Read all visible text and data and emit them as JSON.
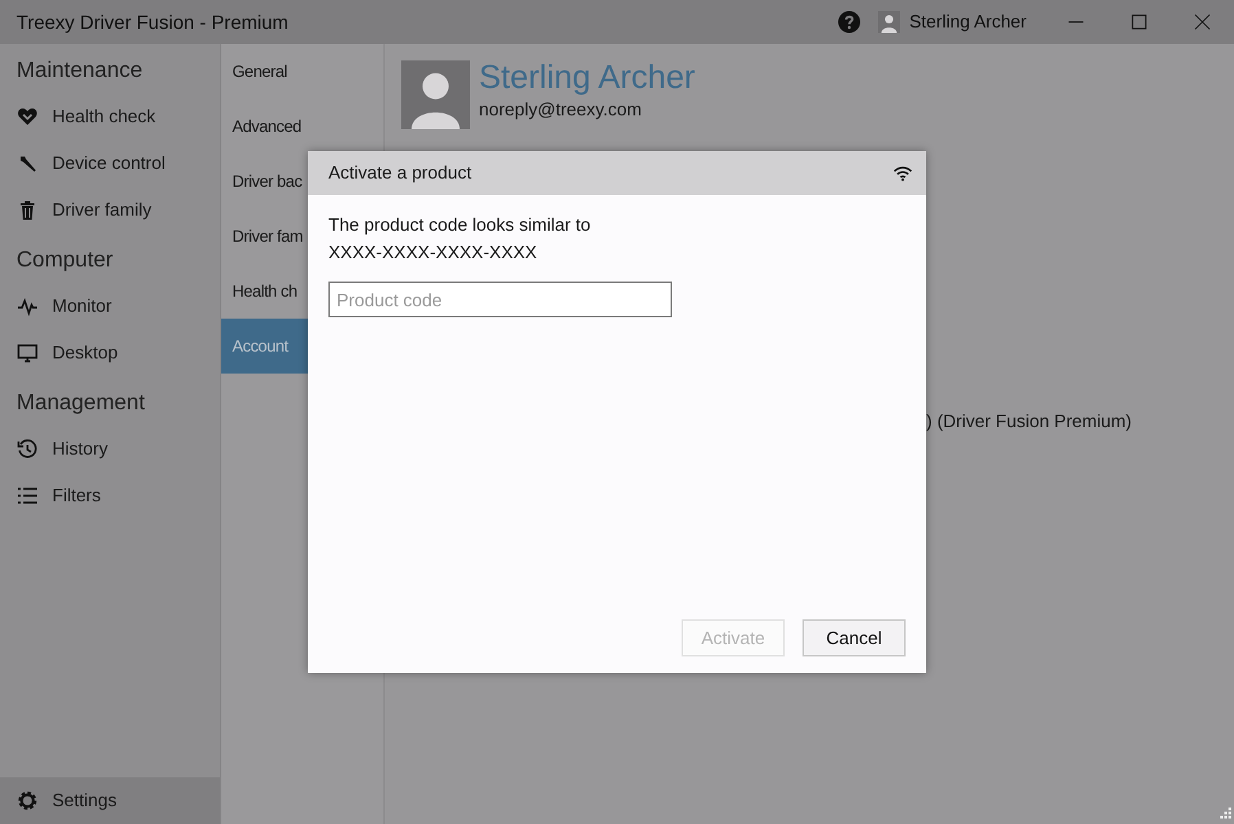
{
  "window": {
    "title": "Treexy Driver Fusion - Premium",
    "user_name": "Sterling Archer"
  },
  "sidebar": {
    "sections": [
      {
        "heading": "Maintenance",
        "items": [
          {
            "label": "Health check",
            "selected": false
          },
          {
            "label": "Device control",
            "selected": false
          },
          {
            "label": "Driver family",
            "selected": false
          }
        ]
      },
      {
        "heading": "Computer",
        "items": [
          {
            "label": "Monitor",
            "selected": false
          },
          {
            "label": "Desktop",
            "selected": false
          }
        ]
      },
      {
        "heading": "Management",
        "items": [
          {
            "label": "History",
            "selected": false
          },
          {
            "label": "Filters",
            "selected": false
          }
        ]
      }
    ],
    "footer": {
      "label": "Settings",
      "selected": true
    }
  },
  "settings_tabs": [
    {
      "label": "General",
      "selected": false
    },
    {
      "label": "Advanced",
      "selected": false
    },
    {
      "label": "Driver bac",
      "selected": false
    },
    {
      "label": "Driver fam",
      "selected": false
    },
    {
      "label": "Health ch",
      "selected": false
    },
    {
      "label": "Account",
      "selected": true
    }
  ],
  "account": {
    "name": "Sterling Archer",
    "email": "noreply@treexy.com",
    "license": ") (Driver Fusion Premium)"
  },
  "dialog": {
    "title": "Activate a product",
    "message": "The product code looks similar to",
    "example": "XXXX-XXXX-XXXX-XXXX",
    "field": {
      "placeholder": "Product code"
    },
    "buttons": [
      {
        "label": "Activate",
        "disabled": true
      },
      {
        "label": "Cancel",
        "disabled": false
      }
    ]
  }
}
